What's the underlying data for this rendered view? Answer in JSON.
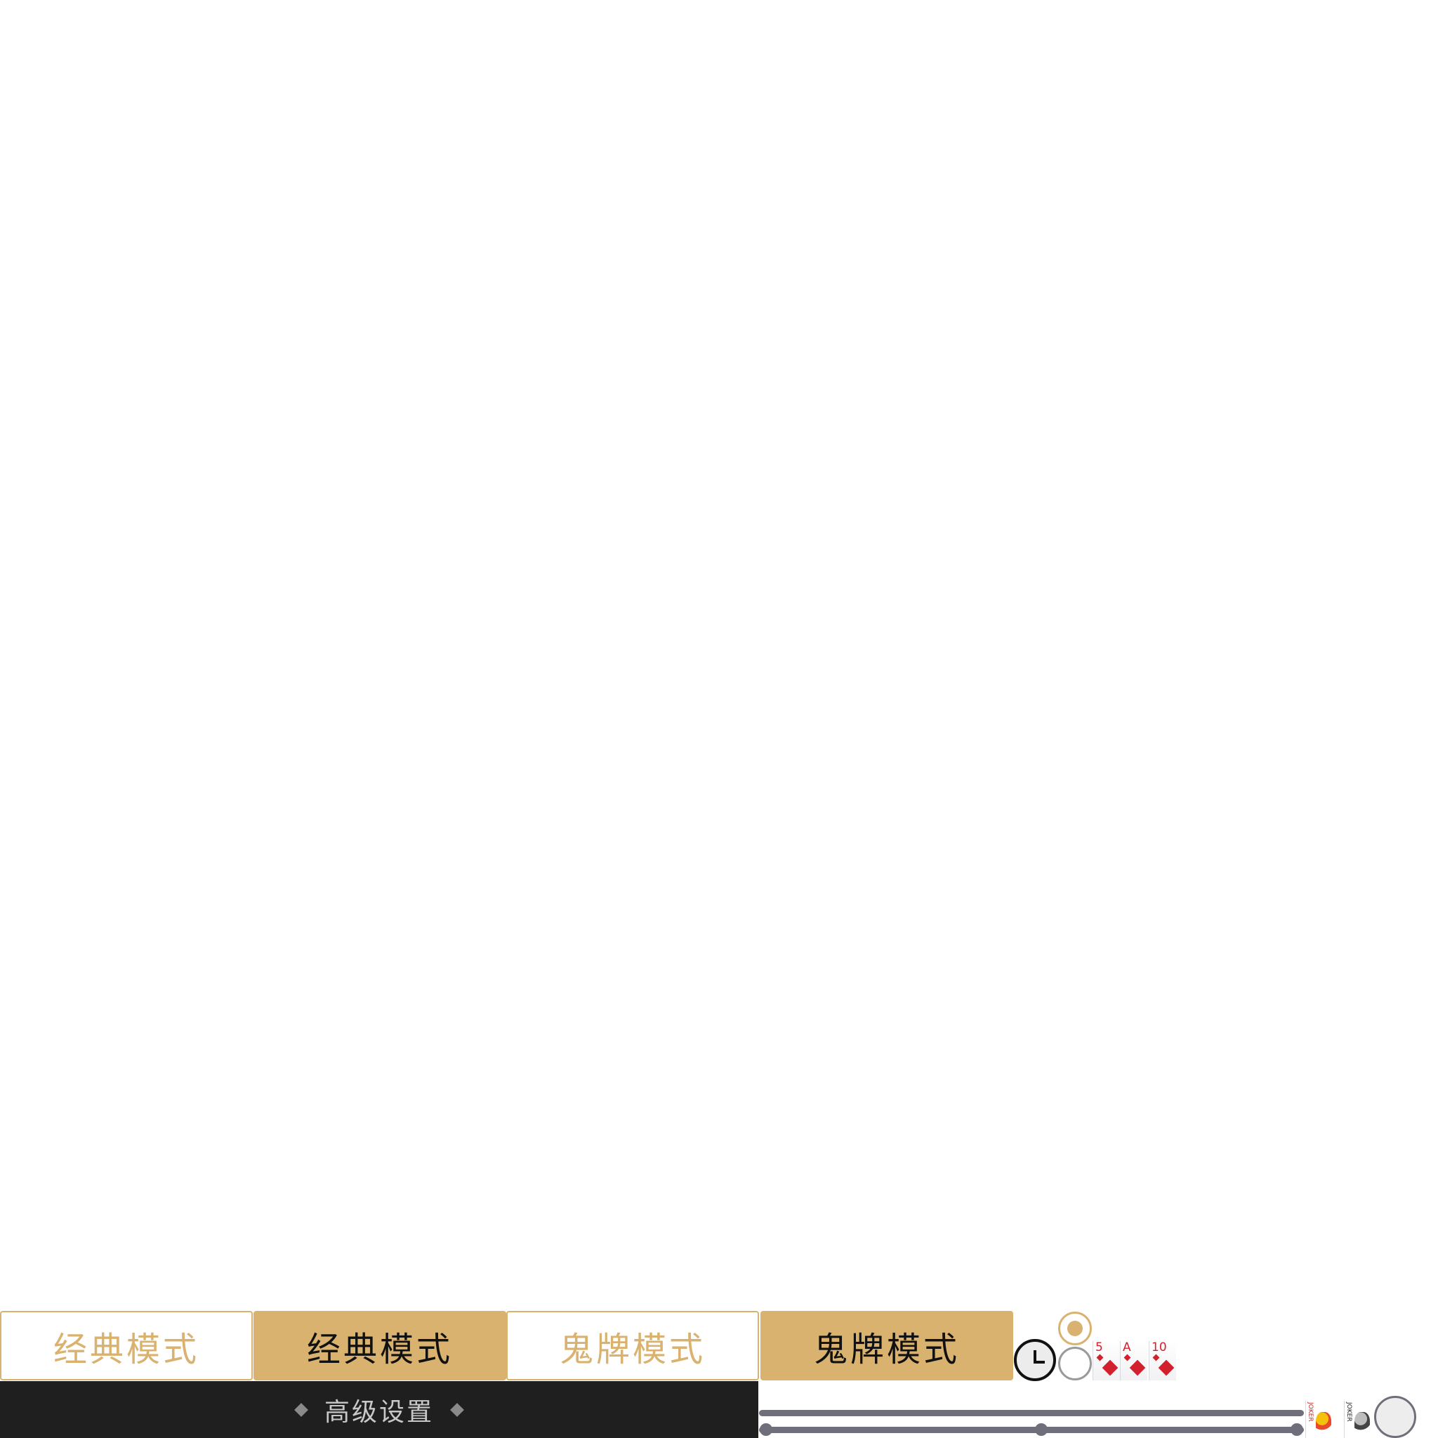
{
  "mode_buttons": [
    {
      "label": "经典模式",
      "state": "normal"
    },
    {
      "label": "经典模式",
      "state": "selected"
    },
    {
      "label": "鬼牌模式",
      "state": "normal"
    },
    {
      "label": "鬼牌模式",
      "state": "selected"
    }
  ],
  "advanced_settings": {
    "label": "高级设置"
  },
  "radio": {
    "options": [
      {
        "checked": true
      },
      {
        "checked": false
      }
    ]
  },
  "cards": [
    {
      "rank": "5",
      "suit": "diamond"
    },
    {
      "rank": "A",
      "suit": "diamond"
    },
    {
      "rank": "10",
      "suit": "diamond"
    }
  ],
  "jokers": [
    {
      "text": "JOKER",
      "color": "red"
    },
    {
      "text": "JOKER",
      "color": "black"
    }
  ],
  "colors": {
    "accent": "#d9b26f",
    "bar_background": "#1f1f1f",
    "slider": "#6e6f7a",
    "suit_red": "#d3202e"
  }
}
